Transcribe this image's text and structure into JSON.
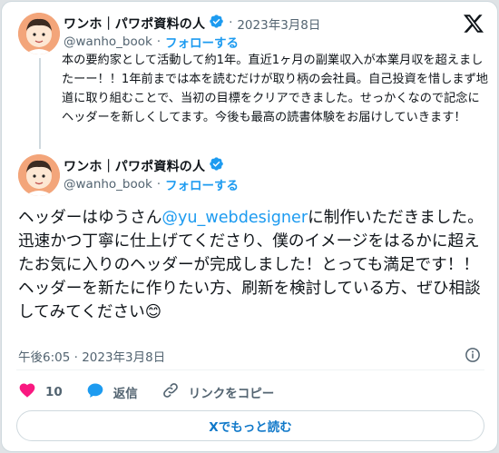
{
  "quoted_tweet": {
    "display_name": "ワンホ｜パワポ資料の人",
    "date": "2023年3月8日",
    "handle": "@wanho_book",
    "follow_label": "フォローする",
    "text": "本の要約家として活動して約1年。直近1ヶ月の副業収入が本業月収を超えましたーー！！1年前までは本を読むだけが取り柄の会社員。自己投資を惜しまず地道に取り組むことで、当初の目標をクリアできました。せっかくなので記念にヘッダーを新しくしてます。今後も最高の読書体験をお届けしていきます！"
  },
  "main_tweet": {
    "display_name": "ワンホ｜パワポ資料の人",
    "handle": "@wanho_book",
    "follow_label": "フォローする",
    "text_before": "ヘッダーはゆうさん",
    "mention": "@yu_webdesigner",
    "text_after": "に制作いただきました。迅速かつ丁寧に仕上げてくださり、僕のイメージをはるかに超えたお気に入りのヘッダーが完成しました！とっても満足です！！ヘッダーを新たに作りたい方、刷新を検討している方、ぜひ相談してみてください",
    "emoji": "😊",
    "timestamp": "午後6:05 · 2023年3月8日"
  },
  "actions": {
    "like_count": "10",
    "reply_label": "返信",
    "copy_link_label": "リンクをコピー"
  },
  "read_more_label": "Xでもっと読む",
  "separator": "·",
  "colors": {
    "accent": "#1d9bf0",
    "like": "#f91880",
    "avatar_bg": "#f3a57a"
  },
  "icons": [
    "x-logo-icon",
    "verified-badge-icon",
    "heart-icon",
    "reply-bubble-icon",
    "link-icon",
    "info-icon"
  ]
}
